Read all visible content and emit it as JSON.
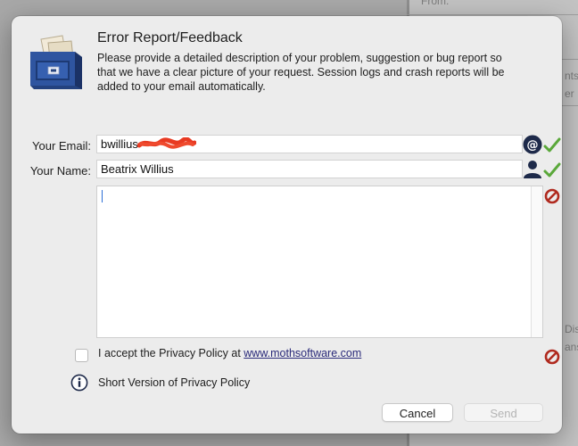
{
  "background": {
    "texts": [
      "From:",
      "nts",
      "er",
      "Dis",
      "ans"
    ]
  },
  "dialog": {
    "title": "Error Report/Feedback",
    "description": "Please provide a detailed description of your problem, suggestion or bug report so that we have a clear picture of your request. Session logs and crash reports will be added to your email automatically.",
    "email": {
      "label": "Your Email:",
      "value": "bwillius",
      "icon": "at-icon",
      "status": "valid"
    },
    "name": {
      "label": "Your Name:",
      "value": "Beatrix Willius",
      "icon": "person-icon",
      "status": "valid"
    },
    "message": {
      "value": "",
      "status": "invalid"
    },
    "privacy": {
      "checked": false,
      "text": "I accept the Privacy Policy at",
      "link": "www.mothsoftware.com",
      "status": "invalid"
    },
    "short_policy": "Short Version of Privacy Policy",
    "buttons": {
      "cancel": "Cancel",
      "send": "Send"
    }
  },
  "colors": {
    "check": "#5aa83a",
    "error": "#b02a1f",
    "redaction": "#e83a22",
    "icon_dark": "#1e2a4a"
  }
}
